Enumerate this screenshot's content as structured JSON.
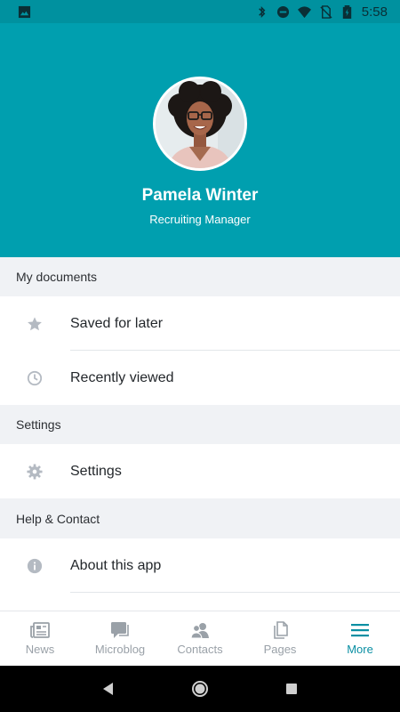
{
  "status_bar": {
    "time": "5:58"
  },
  "profile": {
    "name": "Pamela Winter",
    "role": "Recruiting Manager"
  },
  "sections": {
    "documents": {
      "header": "My documents",
      "items": [
        {
          "label": "Saved for later",
          "icon": "star-icon"
        },
        {
          "label": "Recently viewed",
          "icon": "clock-icon"
        }
      ]
    },
    "settings": {
      "header": "Settings",
      "items": [
        {
          "label": "Settings",
          "icon": "gear-icon"
        }
      ]
    },
    "help": {
      "header": "Help & Contact",
      "items": [
        {
          "label": "About this app",
          "icon": "info-icon"
        }
      ]
    }
  },
  "bottom_nav": {
    "items": [
      {
        "label": "News",
        "icon": "news-icon"
      },
      {
        "label": "Microblog",
        "icon": "microblog-icon"
      },
      {
        "label": "Contacts",
        "icon": "contacts-icon"
      },
      {
        "label": "Pages",
        "icon": "pages-icon"
      },
      {
        "label": "More",
        "icon": "menu-icon",
        "active": true
      }
    ]
  },
  "colors": {
    "header_bg": "#009faf",
    "status_bar_bg": "#00919f",
    "accent": "#0a8fa3",
    "section_bg": "#f0f2f5",
    "icon_grey": "#b4bac2"
  }
}
